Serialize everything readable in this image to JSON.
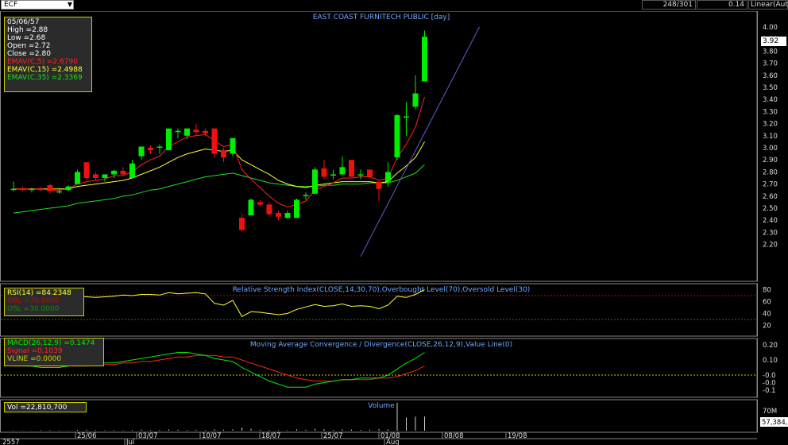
{
  "toolbar": {
    "symbol": "ECF",
    "bar_count": "248/301",
    "field_value": "0.14",
    "scale_mode": "Linear(Auto)"
  },
  "ohlc_box": {
    "date": "05/06/57",
    "high": "High  =2.88",
    "low": "Low   =2.68",
    "open": "Open  =2.72",
    "close": "Close =2.80",
    "ema5": "EMAV(C,5)   =2.6790",
    "ema15": "EMAV(C,15)   =2.4988",
    "ema35": "EMAV(C,35)   =2.3369"
  },
  "rsi_box": {
    "rsi": "RSI(14)   =84.2348",
    "obl": "OBL  =70.0000",
    "osl": "OSL   =30.0000"
  },
  "macd_box": {
    "macd": "MACD(26,12,9)   =0.1474",
    "signal": "Signal  =0.1039",
    "vline": "VLINE  =0.0000"
  },
  "vol_box": {
    "vol": "Vol   =22,810,700"
  },
  "last_price": "3.92",
  "colors": {
    "bull": "#00ee00",
    "bear": "#ee1111",
    "ema5": "#ff2222",
    "ema15": "#ffff33",
    "ema35": "#22dd22",
    "trend": "#6a5acd",
    "title": "#6fa8ff",
    "rsi": "#ffff33",
    "macd": "#00ee00",
    "signal": "#ff2222",
    "frame": "#888888",
    "box_border": "#cccc00"
  },
  "chart_data": [
    {
      "type": "candlestick",
      "title": "EAST COAST FURNITECH PUBLIC [day]",
      "ylim": [
        2.1,
        4.05
      ],
      "yticks": [
        "4.00",
        "3.90",
        "3.80",
        "3.70",
        "3.60",
        "3.50",
        "3.40",
        "3.30",
        "3.20",
        "3.10",
        "3.00",
        "2.90",
        "2.80",
        "2.70",
        "2.60",
        "2.50",
        "2.40",
        "2.30",
        "2.20"
      ],
      "candles": [
        {
          "o": 2.66,
          "h": 2.72,
          "l": 2.64,
          "c": 2.66
        },
        {
          "o": 2.66,
          "h": 2.68,
          "l": 2.64,
          "c": 2.65
        },
        {
          "o": 2.65,
          "h": 2.67,
          "l": 2.63,
          "c": 2.66
        },
        {
          "o": 2.66,
          "h": 2.68,
          "l": 2.64,
          "c": 2.65
        },
        {
          "o": 2.69,
          "h": 2.7,
          "l": 2.62,
          "c": 2.64
        },
        {
          "o": 2.64,
          "h": 2.67,
          "l": 2.62,
          "c": 2.64
        },
        {
          "o": 2.65,
          "h": 2.69,
          "l": 2.64,
          "c": 2.68
        },
        {
          "o": 2.7,
          "h": 2.82,
          "l": 2.7,
          "c": 2.8
        },
        {
          "o": 2.88,
          "h": 2.88,
          "l": 2.73,
          "c": 2.75
        },
        {
          "o": 2.78,
          "h": 2.8,
          "l": 2.73,
          "c": 2.75
        },
        {
          "o": 2.75,
          "h": 2.77,
          "l": 2.72,
          "c": 2.78
        },
        {
          "o": 2.78,
          "h": 2.82,
          "l": 2.75,
          "c": 2.81
        },
        {
          "o": 2.81,
          "h": 2.84,
          "l": 2.77,
          "c": 2.78
        },
        {
          "o": 2.75,
          "h": 2.9,
          "l": 2.75,
          "c": 2.87
        },
        {
          "o": 2.93,
          "h": 3.0,
          "l": 2.9,
          "c": 3.01
        },
        {
          "o": 3.0,
          "h": 3.02,
          "l": 2.95,
          "c": 2.98
        },
        {
          "o": 3.0,
          "h": 3.03,
          "l": 2.95,
          "c": 3.01
        },
        {
          "o": 2.98,
          "h": 3.16,
          "l": 2.98,
          "c": 3.16
        },
        {
          "o": 3.14,
          "h": 3.16,
          "l": 3.08,
          "c": 3.14
        },
        {
          "o": 3.1,
          "h": 3.16,
          "l": 3.07,
          "c": 3.16
        },
        {
          "o": 3.15,
          "h": 3.2,
          "l": 3.1,
          "c": 3.13
        },
        {
          "o": 3.14,
          "h": 3.16,
          "l": 3.1,
          "c": 3.12
        },
        {
          "o": 3.16,
          "h": 3.16,
          "l": 2.92,
          "c": 2.95
        },
        {
          "o": 2.98,
          "h": 3.0,
          "l": 2.88,
          "c": 2.92
        },
        {
          "o": 2.95,
          "h": 3.08,
          "l": 2.93,
          "c": 3.08
        },
        {
          "o": 2.42,
          "h": 2.45,
          "l": 2.3,
          "c": 2.32
        },
        {
          "o": 2.44,
          "h": 2.58,
          "l": 2.44,
          "c": 2.57
        },
        {
          "o": 2.55,
          "h": 2.57,
          "l": 2.52,
          "c": 2.53
        },
        {
          "o": 2.53,
          "h": 2.55,
          "l": 2.43,
          "c": 2.45
        },
        {
          "o": 2.46,
          "h": 2.48,
          "l": 2.4,
          "c": 2.43
        },
        {
          "o": 2.42,
          "h": 2.48,
          "l": 2.41,
          "c": 2.46
        },
        {
          "o": 2.42,
          "h": 2.58,
          "l": 2.42,
          "c": 2.57
        },
        {
          "o": 2.6,
          "h": 2.63,
          "l": 2.57,
          "c": 2.61
        },
        {
          "o": 2.62,
          "h": 2.84,
          "l": 2.62,
          "c": 2.82
        },
        {
          "o": 2.83,
          "h": 2.9,
          "l": 2.74,
          "c": 2.76
        },
        {
          "o": 2.78,
          "h": 2.82,
          "l": 2.74,
          "c": 2.78
        },
        {
          "o": 2.78,
          "h": 2.93,
          "l": 2.78,
          "c": 2.84
        },
        {
          "o": 2.9,
          "h": 2.9,
          "l": 2.76,
          "c": 2.76
        },
        {
          "o": 2.78,
          "h": 2.82,
          "l": 2.74,
          "c": 2.78
        },
        {
          "o": 2.82,
          "h": 2.82,
          "l": 2.76,
          "c": 2.76
        },
        {
          "o": 2.72,
          "h": 2.72,
          "l": 2.56,
          "c": 2.66
        },
        {
          "o": 2.72,
          "h": 2.88,
          "l": 2.68,
          "c": 2.8
        },
        {
          "o": 2.92,
          "h": 3.28,
          "l": 2.9,
          "c": 3.27
        },
        {
          "o": 3.26,
          "h": 3.38,
          "l": 3.1,
          "c": 3.26
        },
        {
          "o": 3.34,
          "h": 3.6,
          "l": 3.32,
          "c": 3.45
        },
        {
          "o": 3.55,
          "h": 3.97,
          "l": 3.55,
          "c": 3.92
        }
      ],
      "ema5": [
        2.66,
        2.66,
        2.66,
        2.66,
        2.65,
        2.65,
        2.66,
        2.7,
        2.72,
        2.73,
        2.74,
        2.77,
        2.77,
        2.8,
        2.86,
        2.9,
        2.93,
        3.01,
        3.05,
        3.09,
        3.1,
        3.11,
        3.06,
        3.01,
        3.03,
        2.82,
        2.74,
        2.67,
        2.6,
        2.54,
        2.51,
        2.53,
        2.56,
        2.65,
        2.68,
        2.71,
        2.75,
        2.75,
        2.76,
        2.76,
        2.73,
        2.75,
        2.92,
        3.03,
        3.17,
        3.42
      ],
      "ema15": [
        2.66,
        2.66,
        2.66,
        2.66,
        2.66,
        2.66,
        2.66,
        2.68,
        2.69,
        2.7,
        2.71,
        2.72,
        2.73,
        2.75,
        2.78,
        2.81,
        2.84,
        2.88,
        2.92,
        2.95,
        2.97,
        2.99,
        2.98,
        2.97,
        2.98,
        2.9,
        2.86,
        2.82,
        2.78,
        2.73,
        2.7,
        2.68,
        2.67,
        2.69,
        2.7,
        2.71,
        2.72,
        2.72,
        2.72,
        2.72,
        2.71,
        2.72,
        2.79,
        2.85,
        2.92,
        3.05
      ],
      "ema35": [
        2.46,
        2.47,
        2.48,
        2.49,
        2.5,
        2.51,
        2.52,
        2.54,
        2.55,
        2.56,
        2.57,
        2.58,
        2.6,
        2.61,
        2.63,
        2.65,
        2.66,
        2.68,
        2.7,
        2.72,
        2.74,
        2.76,
        2.77,
        2.78,
        2.79,
        2.77,
        2.75,
        2.73,
        2.71,
        2.7,
        2.69,
        2.68,
        2.68,
        2.68,
        2.69,
        2.69,
        2.7,
        2.7,
        2.7,
        2.71,
        2.71,
        2.71,
        2.73,
        2.76,
        2.79,
        2.86
      ],
      "trendline": {
        "from": {
          "bar": 38,
          "price": 2.1
        },
        "to": {
          "bar": 51,
          "price": 4.0
        }
      }
    },
    {
      "type": "line",
      "title": "Relative Strength Index(CLOSE,14,30,70),Overbought Level(70),Oversold Level(30)",
      "ylim": [
        10,
        90
      ],
      "yticks": [
        "80",
        "60",
        "40",
        "20"
      ],
      "series": [
        {
          "values": [
            72,
            69,
            70,
            67,
            66,
            66,
            67,
            69,
            68,
            67,
            68,
            69,
            71,
            70,
            72,
            72,
            71,
            75,
            73,
            74,
            75,
            73,
            57,
            54,
            62,
            35,
            43,
            42,
            40,
            38,
            40,
            47,
            51,
            55,
            52,
            53,
            56,
            52,
            53,
            52,
            48,
            54,
            69,
            67,
            72,
            80
          ]
        }
      ],
      "levels": [
        70,
        30
      ]
    },
    {
      "type": "line",
      "title": "Moving Average Convergence / Divergence(CLOSE,26,12,9),Value Line(0)",
      "ylim": [
        -0.15,
        0.25
      ],
      "yticks": [
        "0.20",
        "0.10",
        "-0.0",
        "-0.0",
        "-0.1"
      ],
      "series": [
        {
          "values": [
            0.07,
            0.06,
            0.06,
            0.05,
            0.05,
            0.05,
            0.06,
            0.07,
            0.07,
            0.07,
            0.08,
            0.08,
            0.09,
            0.1,
            0.11,
            0.12,
            0.13,
            0.14,
            0.15,
            0.15,
            0.14,
            0.13,
            0.11,
            0.1,
            0.09,
            0.05,
            0.02,
            -0.01,
            -0.04,
            -0.06,
            -0.08,
            -0.08,
            -0.08,
            -0.06,
            -0.05,
            -0.04,
            -0.03,
            -0.03,
            -0.02,
            -0.02,
            -0.02,
            0.0,
            0.04,
            0.08,
            0.11,
            0.15
          ]
        },
        {
          "values": [
            0.06,
            0.06,
            0.06,
            0.06,
            0.06,
            0.06,
            0.06,
            0.06,
            0.06,
            0.07,
            0.07,
            0.07,
            0.08,
            0.08,
            0.09,
            0.09,
            0.1,
            0.11,
            0.12,
            0.12,
            0.13,
            0.13,
            0.13,
            0.12,
            0.12,
            0.1,
            0.08,
            0.06,
            0.04,
            0.02,
            0.0,
            -0.02,
            -0.03,
            -0.04,
            -0.04,
            -0.04,
            -0.03,
            -0.03,
            -0.03,
            -0.03,
            -0.02,
            -0.02,
            -0.01,
            0.01,
            0.03,
            0.06
          ]
        }
      ],
      "levels": [
        0
      ]
    },
    {
      "type": "bar",
      "title": "Volume",
      "yticks": [
        "70M",
        "57,384,"
      ],
      "values": [
        0.3,
        0.2,
        0.2,
        0.3,
        0.4,
        0.3,
        0.2,
        0.5,
        0.6,
        0.4,
        0.3,
        0.4,
        0.3,
        0.5,
        0.7,
        0.4,
        0.5,
        0.8,
        0.6,
        0.5,
        0.6,
        0.4,
        0.9,
        0.6,
        0.8,
        2.0,
        1.2,
        0.6,
        0.5,
        0.4,
        0.4,
        0.8,
        0.6,
        1.2,
        1.0,
        0.5,
        0.8,
        0.7,
        0.5,
        0.6,
        1.0,
        0.9,
        17.6,
        8.3,
        8.9,
        8.8
      ],
      "ylim": [
        0,
        70
      ]
    }
  ],
  "xaxis": {
    "dates": [
      "25/06",
      "03/07",
      "10/07",
      "18/07",
      "25/07",
      "01/08",
      "08/08",
      "19/08"
    ],
    "months": [
      "Jul",
      "Aug"
    ],
    "year": "2557"
  }
}
